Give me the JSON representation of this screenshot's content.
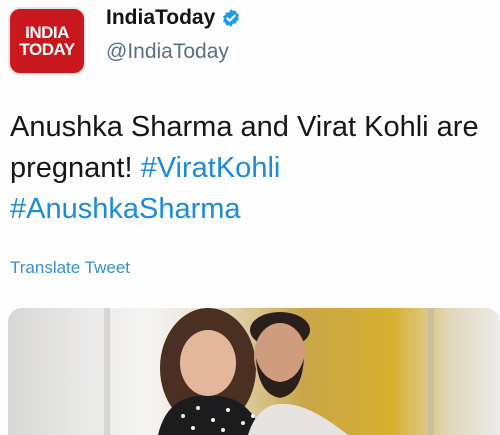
{
  "account": {
    "logo_line1": "INDIA",
    "logo_line2": "TODAY",
    "display_name": "IndiaToday",
    "handle": "@IndiaToday",
    "verified": true
  },
  "tweet": {
    "text": "Anushka Sharma and Virat Kohli are pregnant! ",
    "hashtag1": "#ViratKohli",
    "hashtag2": "#AnushkaSharma",
    "translate_label": "Translate Tweet"
  },
  "media": {
    "description_icon": "photo"
  },
  "colors": {
    "brand_red": "#c9191f",
    "link_blue": "#1d8bd6",
    "verified_blue": "#1d9bf0"
  }
}
